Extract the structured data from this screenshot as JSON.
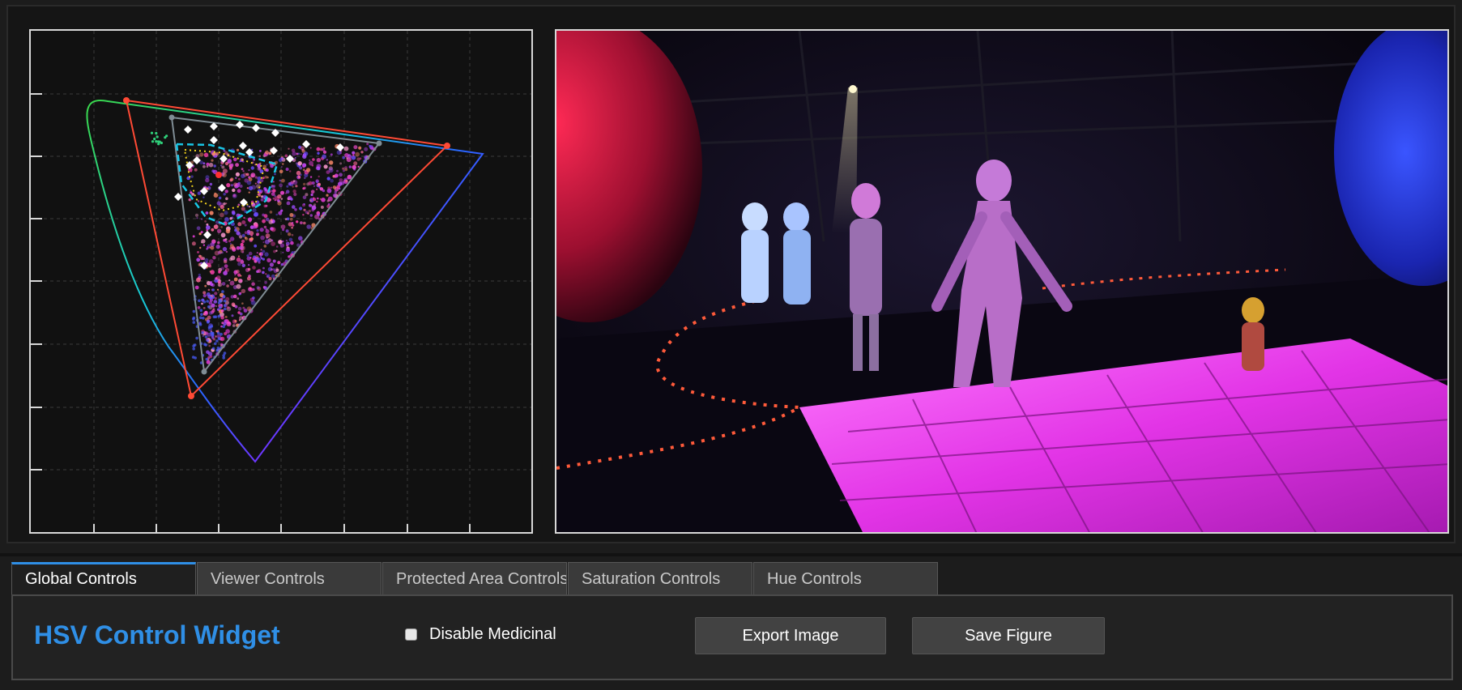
{
  "tabs": [
    {
      "label": "Global Controls",
      "active": true
    },
    {
      "label": "Viewer Controls",
      "active": false
    },
    {
      "label": "Protected Area Controls",
      "active": false
    },
    {
      "label": "Saturation Controls",
      "active": false
    },
    {
      "label": "Hue Controls",
      "active": false
    }
  ],
  "controls": {
    "title": "HSV Control Widget",
    "disable_checkbox_label": "Disable Medicinal",
    "disable_checked": false,
    "export_button": "Export Image",
    "save_button": "Save Figure"
  },
  "colors": {
    "accent": "#2f8fe6",
    "gamut_red": "#ff4a35",
    "gamut_gray": "#7f8c94",
    "protected_cyan": "#19c6e6",
    "protected_yellow": "#f2d21e",
    "panel_border": "#d8d8d8"
  },
  "viewer": {
    "image_description_icon": "photo-icon"
  }
}
